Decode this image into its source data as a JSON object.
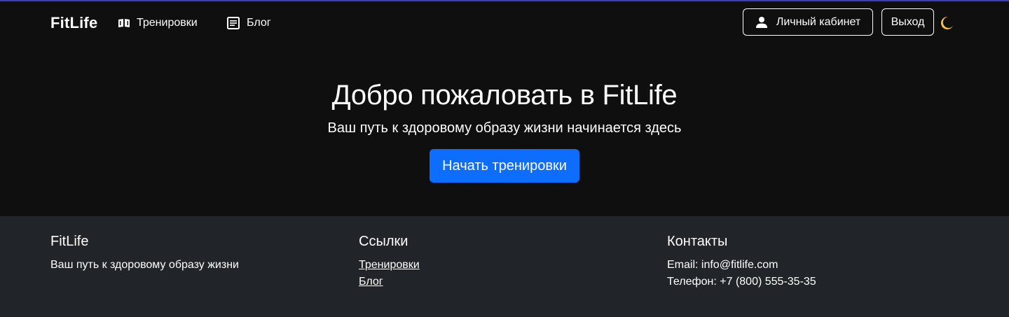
{
  "navbar": {
    "brand": "FitLife",
    "links": [
      {
        "label": "Тренировки",
        "icon": "book-open-icon"
      },
      {
        "label": "Блог",
        "icon": "article-icon"
      }
    ],
    "account_button": {
      "label": "Личный кабинет",
      "icon": "user-icon"
    },
    "logout_button": {
      "label": "Выход"
    },
    "theme_toggle": {
      "icon": "moon-icon",
      "color": "#f5c542"
    },
    "accent_line_color": "#3f3db8"
  },
  "hero": {
    "title": "Добро пожаловать в FitLife",
    "subtitle": "Ваш путь к здоровому образу жизни начинается здесь",
    "cta_label": "Начать тренировки",
    "cta_color": "#0d6efd",
    "background": "#0f0f10"
  },
  "footer": {
    "background": "#212529",
    "brand": {
      "heading": "FitLife",
      "tagline": "Ваш путь к здоровому образу жизни"
    },
    "links": {
      "heading": "Ссылки",
      "items": [
        "Тренировки",
        "Блог"
      ]
    },
    "contacts": {
      "heading": "Контакты",
      "email": "Email: info@fitlife.com",
      "phone": "Телефон: +7 (800) 555-35-35"
    }
  }
}
